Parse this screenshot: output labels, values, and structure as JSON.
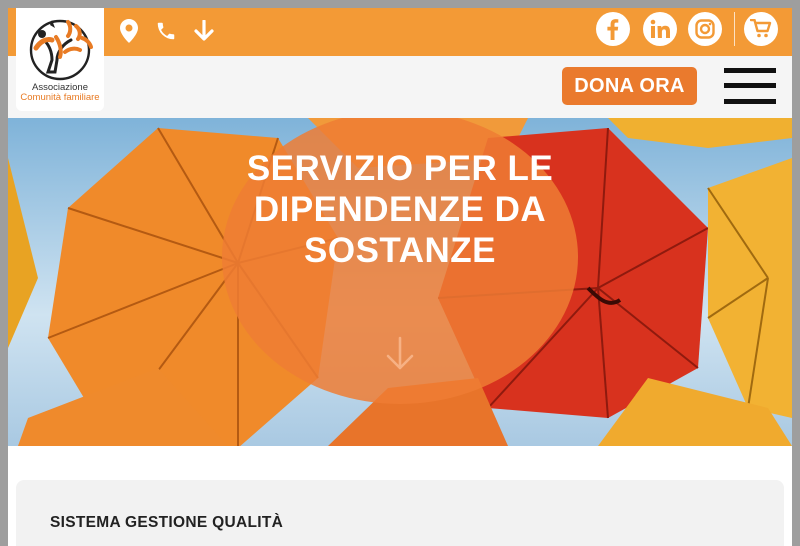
{
  "logo": {
    "line1": "Associazione",
    "line2": "Comunità familiare",
    "icon": "tree-family-logo"
  },
  "topbar": {
    "icons": [
      "location-pin-icon",
      "phone-icon",
      "arrow-down-icon"
    ],
    "social": [
      "facebook-icon",
      "linkedin-icon",
      "instagram-icon",
      "cart-icon"
    ]
  },
  "header": {
    "donate_label": "DONA ORA"
  },
  "hero": {
    "title": "SERVIZIO PER LE DIPENDENZE DA SOSTANZE",
    "scroll_icon": "arrow-down-icon"
  },
  "section": {
    "title": "SISTEMA GESTIONE QUALITÀ"
  },
  "colors": {
    "accent": "#f39a36",
    "button": "#ea7a2d",
    "circle": "#ef7d34"
  }
}
